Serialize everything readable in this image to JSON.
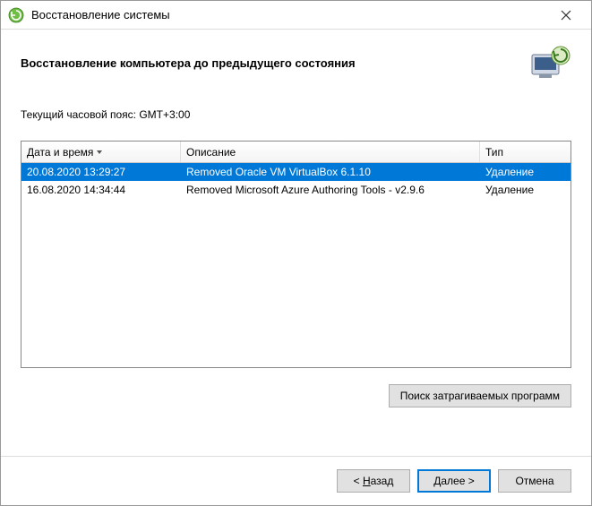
{
  "window": {
    "title": "Восстановление системы"
  },
  "header": {
    "heading": "Восстановление компьютера до предыдущего состояния"
  },
  "content": {
    "timezone_label": "Текущий часовой пояс: GMT+3:00",
    "columns": {
      "date": "Дата и время",
      "desc": "Описание",
      "type": "Тип"
    },
    "rows": [
      {
        "date": "20.08.2020 13:29:27",
        "desc": "Removed Oracle VM VirtualBox 6.1.10",
        "type": "Удаление",
        "selected": true
      },
      {
        "date": "16.08.2020 14:34:44",
        "desc": "Removed Microsoft Azure Authoring Tools - v2.9.6",
        "type": "Удаление",
        "selected": false
      }
    ],
    "scan_button": "Поиск затрагиваемых программ"
  },
  "footer": {
    "back_prefix": "< ",
    "back_u": "Н",
    "back_rest": "азад",
    "next_u": "Д",
    "next_rest": "алее >",
    "cancel": "Отмена"
  }
}
